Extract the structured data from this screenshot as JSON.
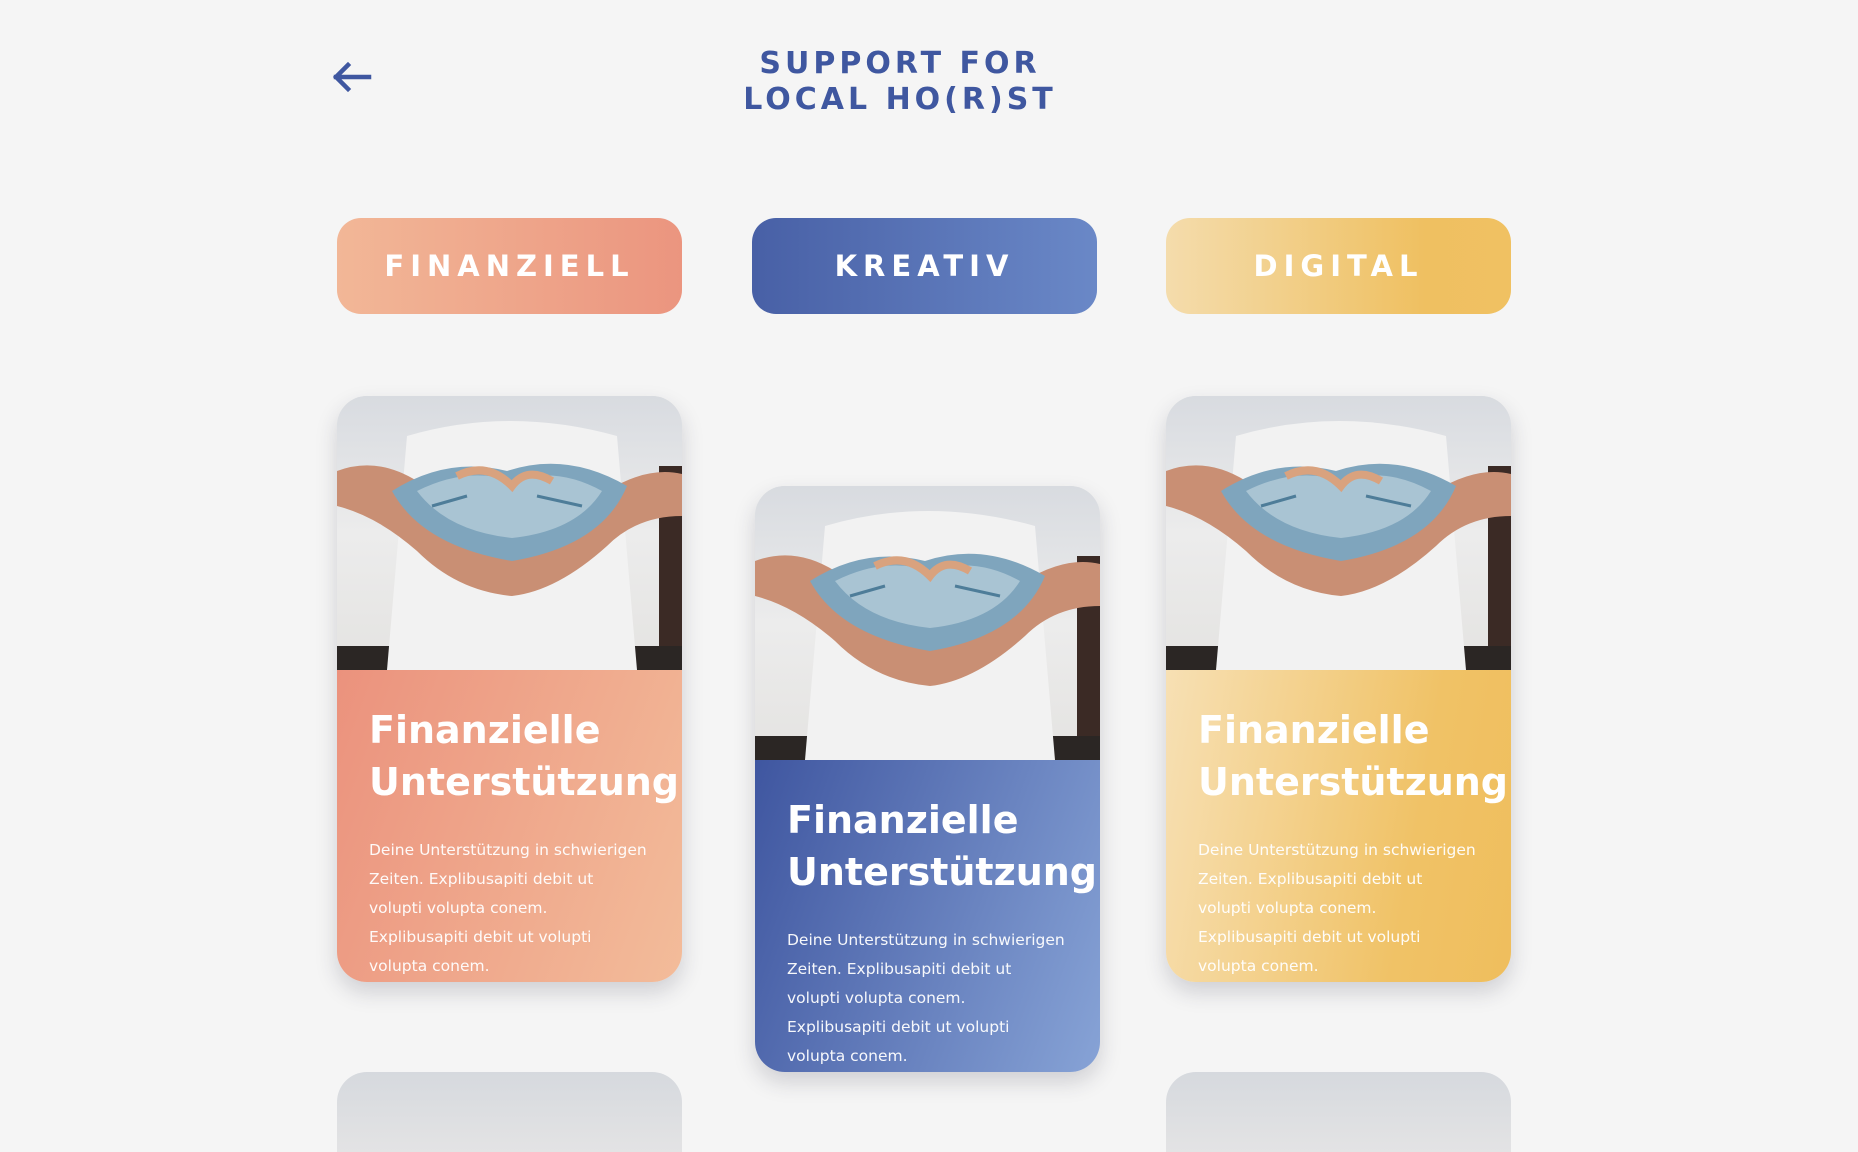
{
  "header": {
    "back_icon": "arrow-left-icon",
    "title_line1": "SUPPORT FOR",
    "title_line2": "LOCAL HO(R)ST",
    "accent_color": "#3f57a0"
  },
  "categories": [
    {
      "label": "FINANZIELL",
      "color": "#ee9f86"
    },
    {
      "label": "KREATIV",
      "color": "#5470b5"
    },
    {
      "label": "DIGITAL",
      "color": "#f0c56c"
    }
  ],
  "cards": [
    {
      "image": "hands-holding-money-photo",
      "title_line1": "Finanzielle",
      "title_line2": "Unterstützung",
      "description": "Deine Unterstützung in schwierigen Zeiten. Explibusapiti debit ut volupti volupta conem. Explibusapiti debit ut volupti volupta conem."
    },
    {
      "image": "hands-holding-money-photo",
      "title_line1": "Finanzielle",
      "title_line2": "Unterstützung",
      "description": "Deine Unterstützung in schwierigen Zeiten. Explibusapiti debit ut volupti volupta conem. Explibusapiti debit ut volupti volupta conem."
    },
    {
      "image": "hands-holding-money-photo",
      "title_line1": "Finanzielle",
      "title_line2": "Unterstützung",
      "description": "Deine Unterstützung in schwierigen Zeiten. Explibusapiti debit ut volupti volupta conem. Explibusapiti debit ut volupti volupta conem."
    }
  ]
}
